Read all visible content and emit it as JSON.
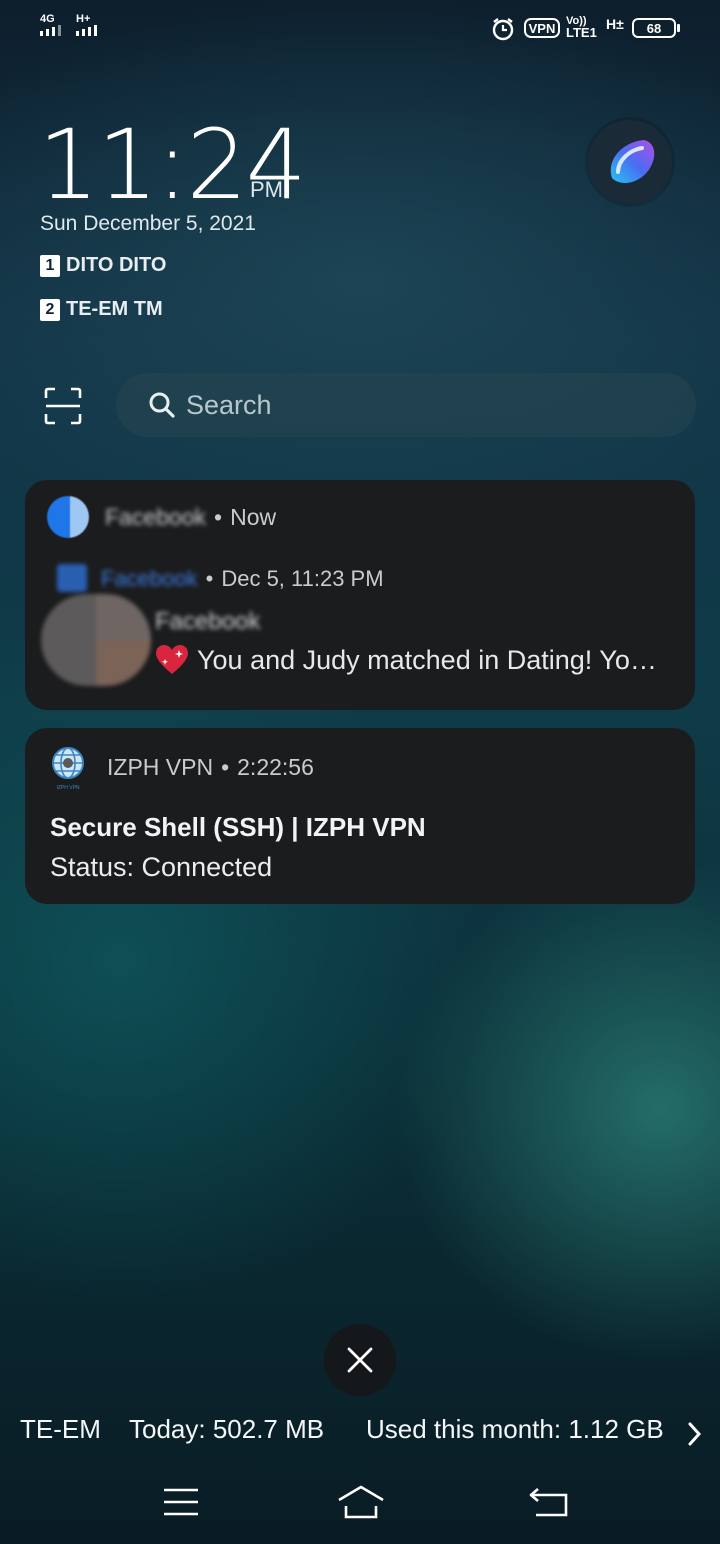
{
  "status_bar": {
    "sim1_network": "4G",
    "sim2_network": "H+",
    "vpn_label": "VPN",
    "volte_top": "Vo))",
    "volte_bottom": "LTE1",
    "hd_label": "H±",
    "battery": "68"
  },
  "lockscreen": {
    "time": "11:24",
    "ampm": "PM",
    "date": "Sun December 5, 2021",
    "sims": [
      {
        "index": "1",
        "carrier": "DITO DITO"
      },
      {
        "index": "2",
        "carrier": "TE-EM TM"
      }
    ],
    "search_placeholder": "Search"
  },
  "notifications": [
    {
      "app": "Facebook",
      "time": "Now",
      "sub_app": "Facebook",
      "sub_time": "Dec 5, 11:23 PM",
      "title": "Facebook",
      "message": "You and Judy matched in Dating! Yo…"
    },
    {
      "app": "IZPH VPN",
      "time": "2:22:56",
      "title": "Secure Shell (SSH) | IZPH VPN",
      "message": "Status: Connected",
      "icon_caption": "IZPH VPN"
    }
  ],
  "data_usage": {
    "carrier": "TE-EM",
    "today": "Today: 502.7 MB",
    "month": "Used this month: 1.12 GB"
  },
  "icons": {
    "clear": "close-icon",
    "scan": "scan-icon",
    "search": "search-icon",
    "nav": [
      "menu-icon",
      "home-icon",
      "back-icon"
    ]
  }
}
